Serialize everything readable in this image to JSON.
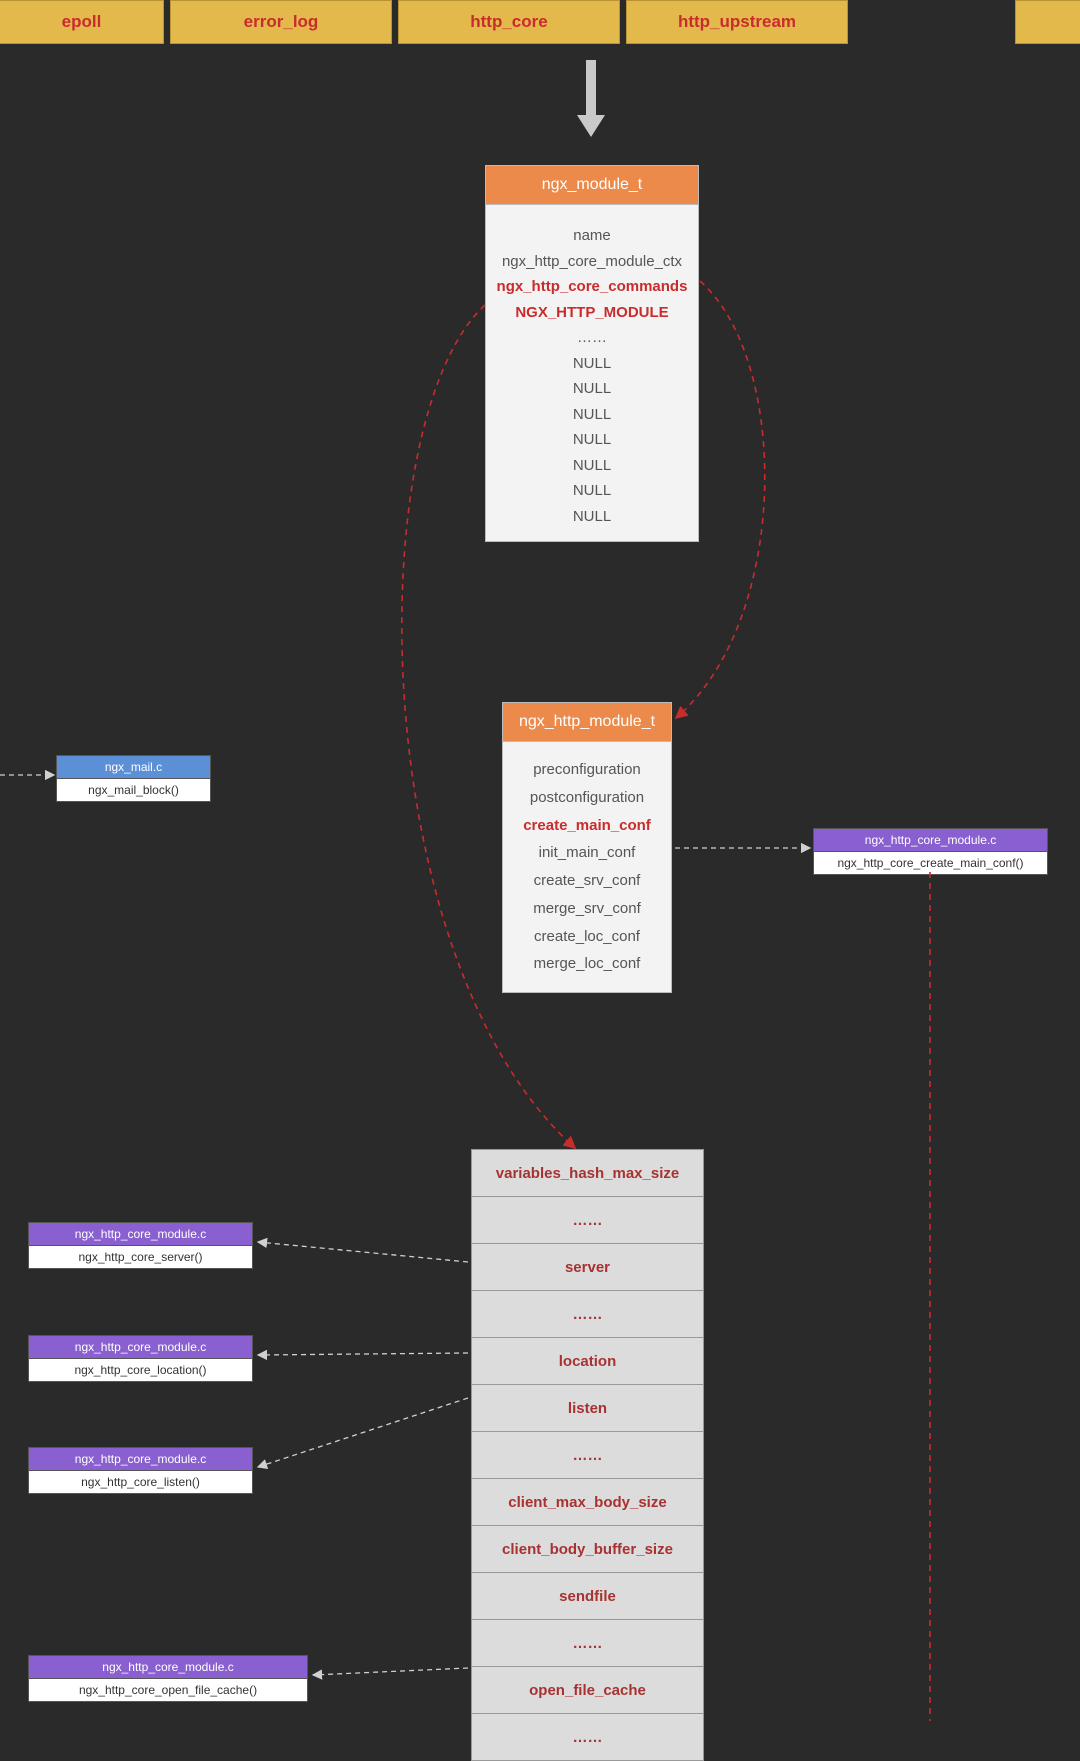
{
  "tabs": [
    "epoll",
    "error_log",
    "http_core",
    "http_upstream",
    ""
  ],
  "module_panel": {
    "title": "ngx_module_t",
    "rows": [
      {
        "text": "name",
        "red": false
      },
      {
        "text": "ngx_http_core_module_ctx",
        "red": false
      },
      {
        "text": "ngx_http_core_commands",
        "red": true
      },
      {
        "text": "NGX_HTTP_MODULE",
        "red": true
      },
      {
        "text": "……",
        "red": false
      },
      {
        "text": "NULL",
        "red": false
      },
      {
        "text": "NULL",
        "red": false
      },
      {
        "text": "NULL",
        "red": false
      },
      {
        "text": "NULL",
        "red": false
      },
      {
        "text": "NULL",
        "red": false
      },
      {
        "text": "NULL",
        "red": false
      },
      {
        "text": "NULL",
        "red": false
      }
    ]
  },
  "http_panel": {
    "title": "ngx_http_module_t",
    "rows": [
      {
        "text": "preconfiguration",
        "red": false
      },
      {
        "text": "postconfiguration",
        "red": false
      },
      {
        "text": "create_main_conf",
        "red": true
      },
      {
        "text": "init_main_conf",
        "red": false
      },
      {
        "text": "create_srv_conf",
        "red": false
      },
      {
        "text": "merge_srv_conf",
        "red": false
      },
      {
        "text": "create_loc_conf",
        "red": false
      },
      {
        "text": "merge_loc_conf",
        "red": false
      }
    ]
  },
  "commands": [
    "variables_hash_max_size",
    "……",
    "server",
    "……",
    "location",
    "listen",
    "……",
    "client_max_body_size",
    "client_body_buffer_size",
    "sendfile",
    "……",
    "open_file_cache",
    "……"
  ],
  "callouts": {
    "mail": {
      "file": "ngx_mail.c",
      "fn": "ngx_mail_block()"
    },
    "create_main": {
      "file": "ngx_http_core_module.c",
      "fn": "ngx_http_core_create_main_conf()"
    },
    "server": {
      "file": "ngx_http_core_module.c",
      "fn": "ngx_http_core_server()"
    },
    "location": {
      "file": "ngx_http_core_module.c",
      "fn": "ngx_http_core_location()"
    },
    "listen": {
      "file": "ngx_http_core_module.c",
      "fn": "ngx_http_core_listen()"
    },
    "ofc": {
      "file": "ngx_http_core_module.c",
      "fn": "ngx_http_core_open_file_cache()"
    }
  }
}
